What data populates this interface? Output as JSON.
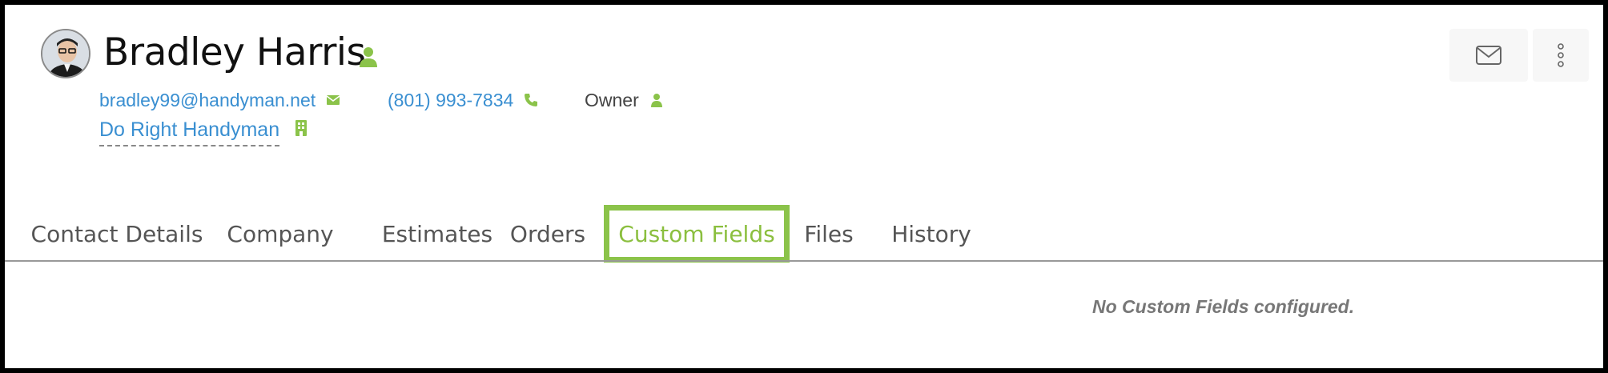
{
  "contact": {
    "name": "Bradley Harris",
    "email": "bradley99@handyman.net",
    "phone": "(801) 993-7834",
    "role": "Owner",
    "company": "Do Right Handyman"
  },
  "header_actions": {
    "email_icon": "envelope-icon",
    "more_icon": "kebab-menu-icon"
  },
  "tabs": [
    {
      "label": "Contact Details",
      "active": false
    },
    {
      "label": "Company",
      "active": false
    },
    {
      "label": "Estimates",
      "active": false
    },
    {
      "label": "Orders",
      "active": false
    },
    {
      "label": "Custom Fields",
      "active": true
    },
    {
      "label": "Files",
      "active": false
    },
    {
      "label": "History",
      "active": false
    }
  ],
  "custom_fields": {
    "empty_message": "No Custom Fields configured."
  },
  "colors": {
    "accent_green": "#8bc34a",
    "link_blue": "#3a8fd1",
    "text_dark": "#111111",
    "text_muted": "#777777"
  }
}
